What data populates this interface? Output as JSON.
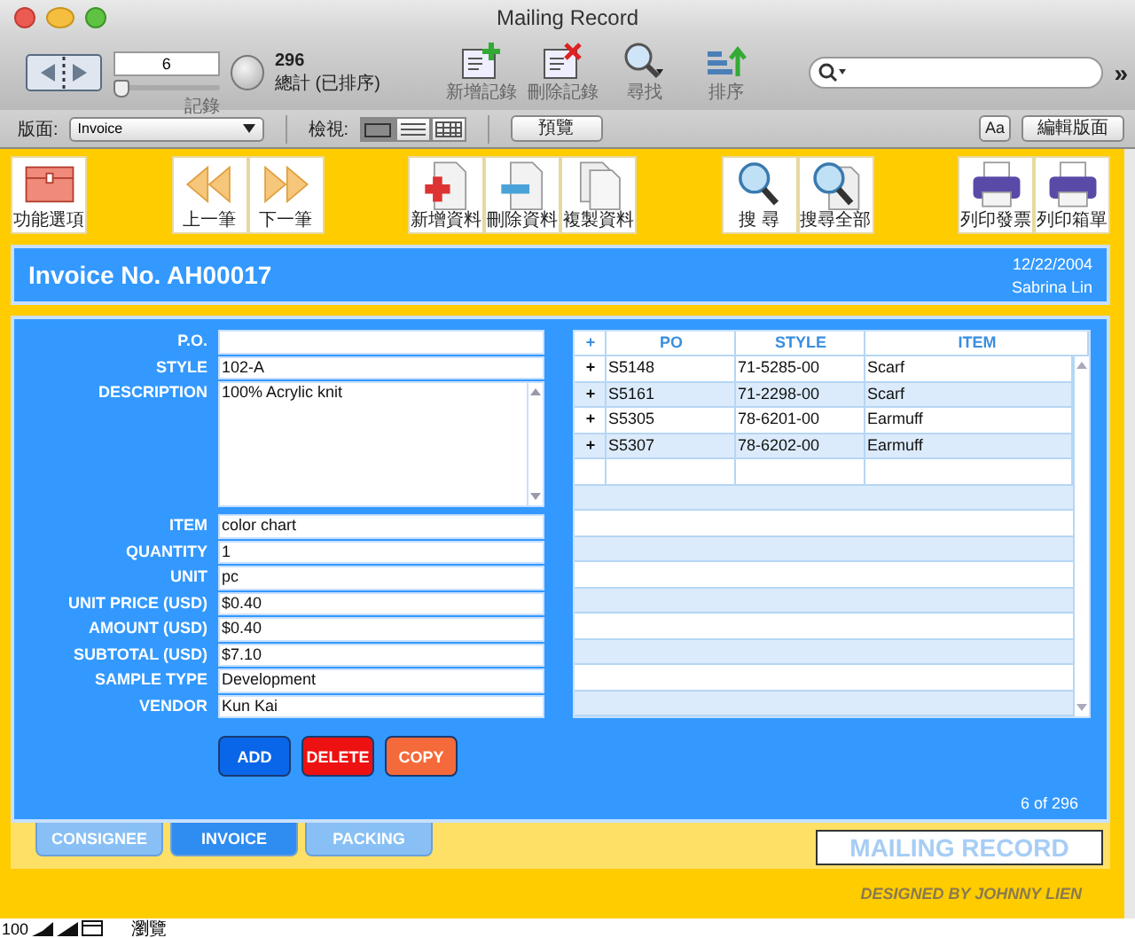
{
  "window": {
    "title": "Mailing Record"
  },
  "toolbar": {
    "record_number": "6",
    "record_slider": {
      "level": 0.02
    },
    "record_label": "記錄",
    "count": "296",
    "count_label": "總計 (已排序)",
    "buttons": [
      {
        "label": "新增記錄",
        "kind": "add"
      },
      {
        "label": "刪除記錄",
        "kind": "delete"
      },
      {
        "label": "尋找",
        "kind": "find"
      },
      {
        "label": "排序",
        "kind": "sort"
      }
    ],
    "overflow": "»"
  },
  "layout_bar": {
    "layout_label": "版面:",
    "layout": "Invoice",
    "view_label": "檢視:",
    "views": [
      {
        "kind": "form",
        "selected": true
      },
      {
        "kind": "list",
        "selected": false
      },
      {
        "kind": "table",
        "selected": false
      }
    ],
    "preview": "預覽",
    "text_button": "Aa",
    "edit_layout": "編輯版面"
  },
  "button_groups": [
    {
      "buttons": [
        {
          "label": "功能選項",
          "kind": "menu"
        }
      ]
    },
    {
      "buttons": [
        {
          "label": "上一筆",
          "kind": "previous"
        },
        {
          "label": "下一筆",
          "kind": "next"
        }
      ]
    },
    {
      "buttons": [
        {
          "label": "新增資料",
          "kind": "add"
        },
        {
          "label": "刪除資料",
          "kind": "remove"
        },
        {
          "label": "複製資料",
          "kind": "copy"
        }
      ]
    },
    {
      "buttons": [
        {
          "label": "搜 尋",
          "kind": "find"
        },
        {
          "label": "搜尋全部",
          "kind": "findall"
        }
      ]
    },
    {
      "buttons": [
        {
          "label": "列印發票",
          "kind": "print"
        },
        {
          "label": "列印箱單",
          "kind": "print"
        }
      ]
    }
  ],
  "header": {
    "title": "Invoice No. AH00017",
    "date": "12/22/2004",
    "user": "Sabrina Lin"
  },
  "fields": [
    {
      "label": "P.O.",
      "kind": "text"
    },
    {
      "label": "STYLE",
      "value": "102-A",
      "kind": "text"
    },
    {
      "label": "DESCRIPTION",
      "value": "100% Acrylic knit",
      "kind": "textarea"
    },
    {
      "label": "ITEM",
      "value": "color chart",
      "kind": "text"
    },
    {
      "label": "QUANTITY",
      "value": "1",
      "kind": "text"
    },
    {
      "label": "UNIT",
      "value": "pc",
      "kind": "text"
    },
    {
      "label": "UNIT PRICE (USD)",
      "value": "$0.40",
      "kind": "text"
    },
    {
      "label": "AMOUNT (USD)",
      "value": "$0.40",
      "kind": "text"
    },
    {
      "label": "SUBTOTAL (USD)",
      "value": "$7.10",
      "kind": "text"
    },
    {
      "label": "SAMPLE TYPE",
      "value": "Development",
      "kind": "text"
    },
    {
      "label": "VENDOR",
      "value": "Kun Kai",
      "kind": "text"
    }
  ],
  "actions": [
    {
      "label": "ADD",
      "kind": "add"
    },
    {
      "label": "DELETE",
      "kind": "delete"
    },
    {
      "label": "COPY",
      "kind": "copy"
    }
  ],
  "table": {
    "columns": [
      "+",
      "PO",
      "STYLE",
      "ITEM"
    ],
    "rows": [
      {
        "cells": [
          "+",
          "S5148",
          "71-5285-00",
          "Scarf"
        ]
      },
      {
        "cells": [
          "+",
          "S5161",
          "71-2298-00",
          "Scarf"
        ]
      },
      {
        "cells": [
          "+",
          "S5305",
          "78-6201-00",
          "Earmuff"
        ]
      },
      {
        "cells": [
          "+",
          "S5307",
          "78-6202-00",
          "Earmuff"
        ]
      }
    ]
  },
  "record_position": "6 of 296",
  "tabs": [
    {
      "label": "CONSIGNEE",
      "selected": false
    },
    {
      "label": "INVOICE",
      "selected": true
    },
    {
      "label": "PACKING",
      "selected": false
    }
  ],
  "logo": "MAILING RECORD",
  "credit": "DESIGNED BY JOHNNY LIEN",
  "status_bar": {
    "zoom": "100",
    "mode": "瀏覽"
  }
}
